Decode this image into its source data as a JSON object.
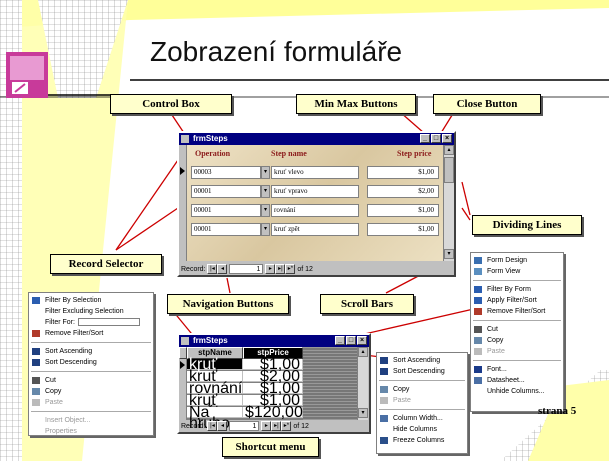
{
  "slide": {
    "title": "Zobrazení formuláře",
    "page_label": "strana 5"
  },
  "callouts": {
    "control_box": "Control Box",
    "min_max": "Min Max Buttons",
    "close_button": "Close Button",
    "dividing_lines": "Dividing Lines",
    "record_selector": "Record Selector",
    "navigation_buttons": "Navigation Buttons",
    "scroll_bars": "Scroll Bars",
    "shortcut_menu": "Shortcut menu"
  },
  "form_window": {
    "title": "frmSteps",
    "headers": {
      "operation": "Operation",
      "step_name": "Step name",
      "step_price": "Step price"
    },
    "rows": [
      {
        "op": "00003",
        "name": "kruť vlevo",
        "price": "$1,00"
      },
      {
        "op": "00001",
        "name": "kruť vpravo",
        "price": "$2,00"
      },
      {
        "op": "00001",
        "name": "rovnání",
        "price": "$1,00"
      },
      {
        "op": "00001",
        "name": "kruť zpět",
        "price": "$1,00"
      }
    ],
    "nav": {
      "record_label": "Record:",
      "current": "1",
      "of_label": "of",
      "total": "12"
    }
  },
  "left_menu": {
    "items": [
      {
        "label": "Filter By Selection",
        "disabled": false
      },
      {
        "label": "Filter Excluding Selection",
        "disabled": false
      },
      {
        "label": "Filter For:",
        "disabled": false
      },
      {
        "label": "Remove Filter/Sort",
        "disabled": false
      },
      {
        "label": "Sort Ascending",
        "disabled": false
      },
      {
        "label": "Sort Descending",
        "disabled": false
      },
      {
        "label": "Cut",
        "disabled": false
      },
      {
        "label": "Copy",
        "disabled": false
      },
      {
        "label": "Paste",
        "disabled": true
      },
      {
        "label": "Insert Object...",
        "disabled": true
      },
      {
        "label": "Properties",
        "disabled": true
      }
    ]
  },
  "grid_window": {
    "title": "frmSteps",
    "headers": {
      "name": "stpName",
      "price": "stpPrice"
    },
    "rows": [
      {
        "name": "kruť vlevo",
        "price": "$1,00"
      },
      {
        "name": "kruť vpravo",
        "price": "$2,00"
      },
      {
        "name": "rovnání",
        "price": "$1,00"
      },
      {
        "name": "kruť zpět",
        "price": "$1,00"
      },
      {
        "name": "Na hrubo",
        "price": "$120,00"
      }
    ],
    "nav": {
      "record_label": "Record:",
      "current": "1",
      "of_label": "of",
      "total": "12"
    }
  },
  "col_menu": {
    "items": [
      {
        "label": "Sort Ascending",
        "disabled": false
      },
      {
        "label": "Sort Descending",
        "disabled": false
      },
      {
        "label": "Copy",
        "disabled": false
      },
      {
        "label": "Paste",
        "disabled": true
      },
      {
        "label": "Column Width...",
        "disabled": false
      },
      {
        "label": "Hide Columns",
        "disabled": false
      },
      {
        "label": "Freeze Columns",
        "disabled": false
      }
    ]
  },
  "right_menu": {
    "items": [
      {
        "label": "Form Design",
        "disabled": false
      },
      {
        "label": "Form View",
        "disabled": false
      },
      {
        "label": "Filter By Form",
        "disabled": false
      },
      {
        "label": "Apply Filter/Sort",
        "disabled": false
      },
      {
        "label": "Remove Filter/Sort",
        "disabled": false
      },
      {
        "label": "Cut",
        "disabled": false
      },
      {
        "label": "Copy",
        "disabled": false
      },
      {
        "label": "Paste",
        "disabled": true
      },
      {
        "label": "Font...",
        "disabled": false
      },
      {
        "label": "Datasheet...",
        "disabled": false
      },
      {
        "label": "Unhide Columns...",
        "disabled": false
      }
    ]
  },
  "colors": {
    "accent_yellow": "#ffff99",
    "callout_line": "#cc0000",
    "titlebar": "#000080"
  }
}
